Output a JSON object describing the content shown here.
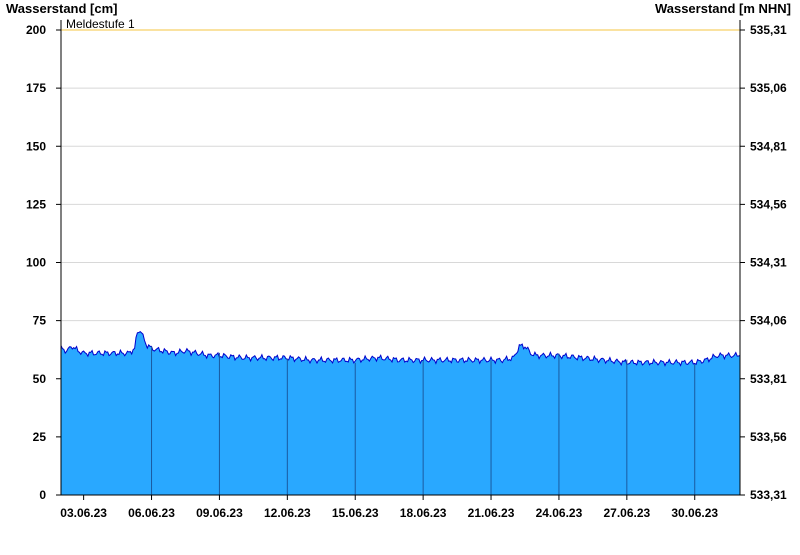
{
  "chart_data": {
    "type": "area",
    "left_axis_title": "Wasserstand [cm]",
    "right_axis_title": "Wasserstand [m NHN]",
    "ylim": [
      0,
      200
    ],
    "yticks_left": [
      "0",
      "25",
      "50",
      "75",
      "100",
      "125",
      "150",
      "175",
      "200"
    ],
    "yticks_right": [
      "533,31",
      "533,56",
      "533,81",
      "534,06",
      "534,31",
      "534,56",
      "534,81",
      "535,06",
      "535,31"
    ],
    "xlim": [
      "2023-06-02",
      "2023-07-02"
    ],
    "xticks": [
      "03.06.23",
      "06.06.23",
      "09.06.23",
      "12.06.23",
      "15.06.23",
      "18.06.23",
      "21.06.23",
      "24.06.23",
      "27.06.23",
      "30.06.23"
    ],
    "threshold": {
      "label": "Meldestufe 1",
      "value": 200,
      "color": "#f5c542"
    },
    "grid": true,
    "colors": {
      "fill": "#29a8ff",
      "line": "#0000cc",
      "grid": "#d8d8d8",
      "day_lines": "#1a5aa0"
    },
    "series": [
      {
        "x": [
          "2023-06-02",
          "2023-06-02T06",
          "2023-06-02T12",
          "2023-06-02T18",
          "2023-06-03",
          "2023-06-03T12",
          "2023-06-04",
          "2023-06-04T12",
          "2023-06-05",
          "2023-06-05T06",
          "2023-06-05T09",
          "2023-06-05T12",
          "2023-06-05T18",
          "2023-06-06",
          "2023-06-06T12",
          "2023-06-07",
          "2023-06-07T12",
          "2023-06-08",
          "2023-06-08T12",
          "2023-06-09",
          "2023-06-10",
          "2023-06-11",
          "2023-06-12",
          "2023-06-13",
          "2023-06-14",
          "2023-06-15",
          "2023-06-16",
          "2023-06-17",
          "2023-06-18",
          "2023-06-19",
          "2023-06-20",
          "2023-06-21",
          "2023-06-21T12",
          "2023-06-22",
          "2023-06-22T06",
          "2023-06-22T12",
          "2023-06-22T18",
          "2023-06-23",
          "2023-06-23T12",
          "2023-06-24",
          "2023-06-25",
          "2023-06-26",
          "2023-06-27",
          "2023-06-28",
          "2023-06-29",
          "2023-06-30",
          "2023-06-30T12",
          "2023-07-01",
          "2023-07-01T12",
          "2023-07-02"
        ],
        "values": [
          63,
          62,
          64,
          62,
          61,
          61,
          61,
          61,
          61,
          63,
          70,
          71,
          65,
          63,
          62,
          61,
          62,
          61,
          60,
          60,
          59,
          59,
          59,
          58,
          58,
          58,
          59,
          58,
          58,
          58,
          58,
          58,
          58,
          59,
          64,
          64,
          61,
          60,
          60,
          60,
          59,
          58,
          57,
          57,
          57,
          57,
          58,
          60,
          60,
          60
        ]
      }
    ]
  }
}
